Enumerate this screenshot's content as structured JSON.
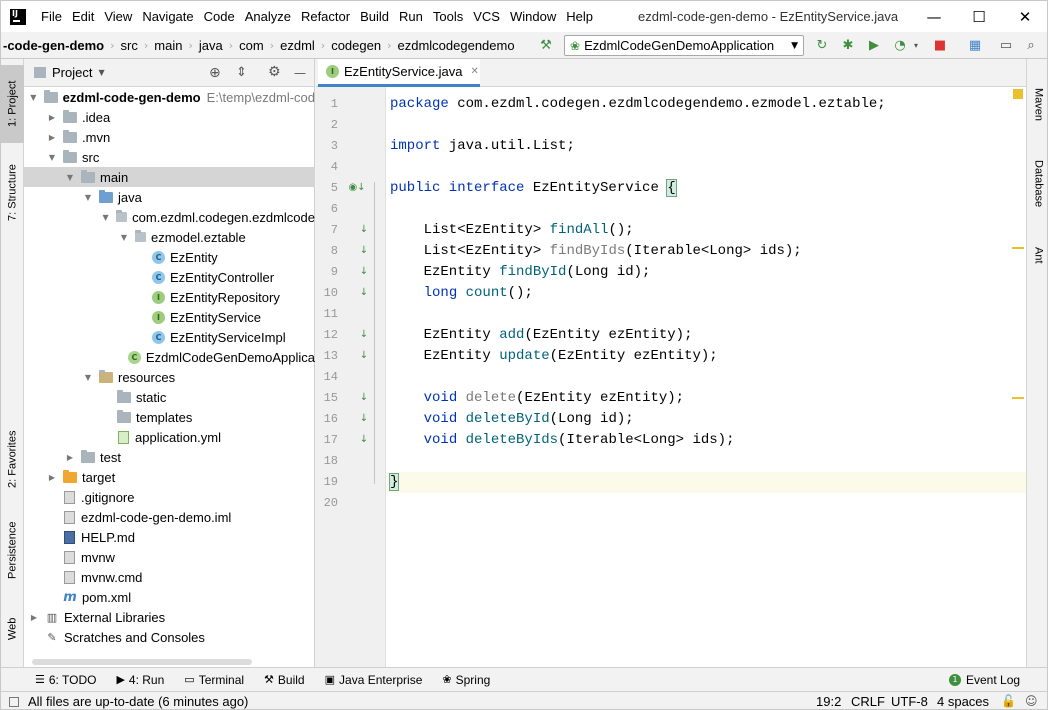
{
  "window": {
    "title": "ezdml-code-gen-demo - EzEntityService.java",
    "minimize": "—",
    "maximize": "☐",
    "close": "✕"
  },
  "menu": [
    {
      "label": "File"
    },
    {
      "label": "Edit"
    },
    {
      "label": "View"
    },
    {
      "label": "Navigate"
    },
    {
      "label": "Code"
    },
    {
      "label": "Analyze"
    },
    {
      "label": "Refactor"
    },
    {
      "label": "Build"
    },
    {
      "label": "Run"
    },
    {
      "label": "Tools"
    },
    {
      "label": "VCS"
    },
    {
      "label": "Window"
    },
    {
      "label": "Help"
    }
  ],
  "breadcrumb": [
    "-code-gen-demo",
    "src",
    "main",
    "java",
    "com",
    "ezdml",
    "codegen",
    "ezdmlcodegendemo"
  ],
  "run_config": {
    "label": "EzdmlCodeGenDemoApplication"
  },
  "left_tabs": {
    "project": "1: Project",
    "structure": "7: Structure",
    "favorites": "2: Favorites",
    "persistence": "Persistence",
    "web": "Web"
  },
  "right_tabs": {
    "maven": "Maven",
    "database": "Database",
    "ant": "Ant"
  },
  "project_panel": {
    "title": "Project",
    "tree": [
      {
        "label": "ezdml-code-gen-demo",
        "hint": "E:\\temp\\ezdml-cod",
        "icon": "folder",
        "arrow": "down",
        "depth": 0,
        "bold": true
      },
      {
        "label": ".idea",
        "icon": "folder",
        "arrow": "right",
        "depth": 1
      },
      {
        "label": ".mvn",
        "icon": "folder",
        "arrow": "right",
        "depth": 1
      },
      {
        "label": "src",
        "icon": "folder",
        "arrow": "down",
        "depth": 1
      },
      {
        "label": "main",
        "icon": "folder",
        "arrow": "down",
        "depth": 2,
        "selected": true
      },
      {
        "label": "java",
        "icon": "folder-blue",
        "arrow": "down",
        "depth": 3
      },
      {
        "label": "com.ezdml.codegen.ezdmlcode",
        "icon": "package",
        "arrow": "down",
        "depth": 4
      },
      {
        "label": "ezmodel.eztable",
        "icon": "package",
        "arrow": "down",
        "depth": 5
      },
      {
        "label": "EzEntity",
        "icon": "class",
        "depth": 6
      },
      {
        "label": "EzEntityController",
        "icon": "class",
        "depth": 6
      },
      {
        "label": "EzEntityRepository",
        "icon": "interface",
        "depth": 6
      },
      {
        "label": "EzEntityService",
        "icon": "interface",
        "depth": 6
      },
      {
        "label": "EzEntityServiceImpl",
        "icon": "class",
        "depth": 6
      },
      {
        "label": "EzdmlCodeGenDemoApplica",
        "icon": "spring-class",
        "depth": 5
      },
      {
        "label": "resources",
        "icon": "folder-res",
        "arrow": "down",
        "depth": 3
      },
      {
        "label": "static",
        "icon": "folder",
        "depth": 4
      },
      {
        "label": "templates",
        "icon": "folder",
        "depth": 4
      },
      {
        "label": "application.yml",
        "icon": "yml",
        "depth": 4
      },
      {
        "label": "test",
        "icon": "folder",
        "arrow": "right",
        "depth": 2
      },
      {
        "label": "target",
        "icon": "folder-orange",
        "arrow": "right",
        "depth": 1
      },
      {
        "label": ".gitignore",
        "icon": "file",
        "depth": 1
      },
      {
        "label": "ezdml-code-gen-demo.iml",
        "icon": "file",
        "depth": 1
      },
      {
        "label": "HELP.md",
        "icon": "md",
        "depth": 1
      },
      {
        "label": "mvnw",
        "icon": "file",
        "depth": 1
      },
      {
        "label": "mvnw.cmd",
        "icon": "file",
        "depth": 1
      },
      {
        "label": "pom.xml",
        "icon": "maven",
        "depth": 1
      },
      {
        "label": "External Libraries",
        "icon": "libs",
        "arrow": "right",
        "depth": 0
      },
      {
        "label": "Scratches and Consoles",
        "icon": "scratch",
        "depth": 0
      }
    ]
  },
  "editor": {
    "tab_label": "EzEntityService.java",
    "lines": [
      {
        "n": "1",
        "html": "<span class='kw'>package</span> com.ezdml.codegen.ezdmlcodegendemo.ezmodel.eztable;"
      },
      {
        "n": "2",
        "html": ""
      },
      {
        "n": "3",
        "html": "<span class='kw'>import</span> java.util.List;"
      },
      {
        "n": "4",
        "html": ""
      },
      {
        "n": "5",
        "html": "<span class='kw'>public interface</span> EzEntityService <span class='brace-hl'>{</span>",
        "mark": "◉↓"
      },
      {
        "n": "6",
        "html": ""
      },
      {
        "n": "7",
        "html": "    List&lt;EzEntity&gt; <span class='fn'>findAll</span>();",
        "mark": "↓"
      },
      {
        "n": "8",
        "html": "    List&lt;EzEntity&gt; <span class='dep'>findByIds</span>(Iterable&lt;Long&gt; ids);",
        "mark": "↓"
      },
      {
        "n": "9",
        "html": "    EzEntity <span class='fn'>findById</span>(Long id);",
        "mark": "↓"
      },
      {
        "n": "10",
        "html": "    <span class='kw'>long</span> <span class='fn'>count</span>();",
        "mark": "↓"
      },
      {
        "n": "11",
        "html": ""
      },
      {
        "n": "12",
        "html": "    EzEntity <span class='fn'>add</span>(EzEntity ezEntity);",
        "mark": "↓"
      },
      {
        "n": "13",
        "html": "    EzEntity <span class='fn'>update</span>(EzEntity ezEntity);",
        "mark": "↓"
      },
      {
        "n": "14",
        "html": ""
      },
      {
        "n": "15",
        "html": "    <span class='kw'>void</span> <span class='dep'>delete</span>(EzEntity ezEntity);",
        "mark": "↓"
      },
      {
        "n": "16",
        "html": "    <span class='kw'>void</span> <span class='fn'>deleteById</span>(Long id);",
        "mark": "↓"
      },
      {
        "n": "17",
        "html": "    <span class='kw'>void</span> <span class='fn'>deleteByIds</span>(Iterable&lt;Long&gt; ids);",
        "mark": "↓"
      },
      {
        "n": "18",
        "html": ""
      },
      {
        "n": "19",
        "html": "<span class='brace-hl'>}</span>",
        "current": true
      },
      {
        "n": "20",
        "html": ""
      }
    ]
  },
  "bottom_tools": [
    {
      "label": "6: TODO",
      "icon": "☰"
    },
    {
      "label": "4: Run",
      "icon": "▶"
    },
    {
      "label": "Terminal",
      "icon": "▭"
    },
    {
      "label": "Build",
      "icon": "⚒"
    },
    {
      "label": "Java Enterprise",
      "icon": "▣"
    },
    {
      "label": "Spring",
      "icon": "❀"
    }
  ],
  "event_log": "Event Log",
  "status": {
    "message": "All files are up-to-date (6 minutes ago)",
    "position": "19:2",
    "line_sep": "CRLF",
    "encoding": "UTF-8",
    "indent": "4 spaces"
  },
  "colors": {
    "accent": "#4083c9",
    "keyword": "#0033b3",
    "method": "#00627a"
  }
}
